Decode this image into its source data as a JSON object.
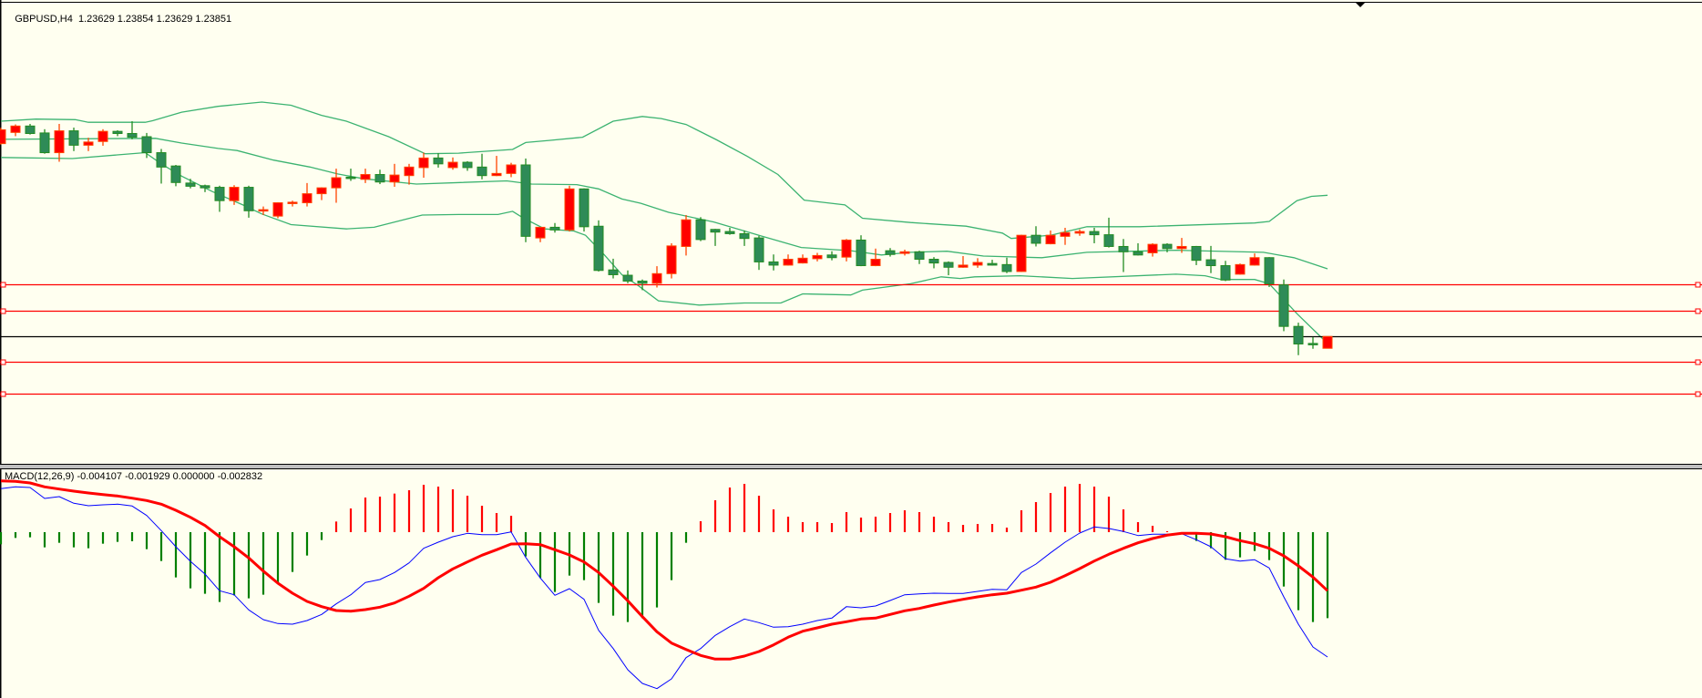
{
  "main_panel": {
    "symbol_timeframe": "GBPUSD,H4",
    "ohlc_readout": "1.23629 1.23854 1.23629 1.23851",
    "bid_price": 1.23851,
    "horizontal_levels": [
      1.2483,
      1.2433,
      1.2337,
      1.2277
    ],
    "colors": {
      "bull_body": "#FF0000",
      "bull_outline": "#FF4500",
      "bear_body": "#2E8B57",
      "bear_outline": "#228B22",
      "bands": "#3CB371",
      "level": "#FF0000",
      "bid": "#000000",
      "background": "#FFFFF0"
    },
    "candles_ohlc": [
      [
        1.2747,
        1.2777,
        1.2745,
        1.2773
      ],
      [
        1.2768,
        1.2783,
        1.2761,
        1.278
      ],
      [
        1.278,
        1.2784,
        1.2764,
        1.2766
      ],
      [
        1.2767,
        1.2774,
        1.2728,
        1.273
      ],
      [
        1.273,
        1.2784,
        1.2713,
        1.2771
      ],
      [
        1.2771,
        1.2777,
        1.2733,
        1.2744
      ],
      [
        1.2744,
        1.2758,
        1.2733,
        1.275
      ],
      [
        1.2751,
        1.2774,
        1.2743,
        1.277
      ],
      [
        1.277,
        1.2772,
        1.2761,
        1.2766
      ],
      [
        1.2766,
        1.2789,
        1.2755,
        1.2759
      ],
      [
        1.276,
        1.2767,
        1.272,
        1.273
      ],
      [
        1.273,
        1.2737,
        1.2672,
        1.2703
      ],
      [
        1.2705,
        1.2707,
        1.2667,
        1.2674
      ],
      [
        1.2673,
        1.2681,
        1.2663,
        1.2667
      ],
      [
        1.2668,
        1.267,
        1.2656,
        1.2664
      ],
      [
        1.2665,
        1.2668,
        1.2619,
        1.264
      ],
      [
        1.264,
        1.2669,
        1.2632,
        1.2665
      ],
      [
        1.2665,
        1.2668,
        1.2608,
        1.2621
      ],
      [
        1.2621,
        1.2629,
        1.2613,
        1.2623
      ],
      [
        1.2611,
        1.2637,
        1.2607,
        1.2636
      ],
      [
        1.2636,
        1.264,
        1.2629,
        1.2637
      ],
      [
        1.2636,
        1.2673,
        1.2629,
        1.2653
      ],
      [
        1.2653,
        1.2665,
        1.2641,
        1.2664
      ],
      [
        1.2664,
        1.27,
        1.2636,
        1.2683
      ],
      [
        1.2684,
        1.27,
        1.2677,
        1.2683
      ],
      [
        1.268,
        1.27,
        1.2673,
        1.2689
      ],
      [
        1.2689,
        1.2698,
        1.2671,
        1.2675
      ],
      [
        1.2675,
        1.2709,
        1.2666,
        1.2688
      ],
      [
        1.2687,
        1.2709,
        1.267,
        1.2703
      ],
      [
        1.2702,
        1.273,
        1.2683,
        1.272
      ],
      [
        1.272,
        1.2729,
        1.2702,
        1.2709
      ],
      [
        1.2702,
        1.2721,
        1.2698,
        1.2712
      ],
      [
        1.2712,
        1.2714,
        1.2696,
        1.2702
      ],
      [
        1.2703,
        1.2728,
        1.268,
        1.2687
      ],
      [
        1.2687,
        1.2724,
        1.2686,
        1.2691
      ],
      [
        1.2691,
        1.2711,
        1.2684,
        1.2707
      ],
      [
        1.2707,
        1.2719,
        1.2562,
        1.2573
      ],
      [
        1.257,
        1.259,
        1.2562,
        1.259
      ],
      [
        1.259,
        1.2598,
        1.258,
        1.2585
      ],
      [
        1.2585,
        1.2668,
        1.2582,
        1.2662
      ],
      [
        1.2662,
        1.2663,
        1.2582,
        1.2591
      ],
      [
        1.2592,
        1.2603,
        1.2507,
        1.2509
      ],
      [
        1.251,
        1.2531,
        1.2494,
        1.2501
      ],
      [
        1.25,
        1.2509,
        1.2485,
        1.2489
      ],
      [
        1.2489,
        1.2492,
        1.2472,
        1.2485
      ],
      [
        1.2485,
        1.2517,
        1.2477,
        1.2503
      ],
      [
        1.2503,
        1.256,
        1.2494,
        1.2555
      ],
      [
        1.2554,
        1.2613,
        1.2537,
        1.2604
      ],
      [
        1.2604,
        1.2609,
        1.2564,
        1.2567
      ],
      [
        1.2586,
        1.2587,
        1.2555,
        1.2581
      ],
      [
        1.2582,
        1.2589,
        1.2576,
        1.2578
      ],
      [
        1.2578,
        1.2584,
        1.2555,
        1.2569
      ],
      [
        1.257,
        1.2574,
        1.251,
        1.2525
      ],
      [
        1.2525,
        1.2539,
        1.2509,
        1.2519
      ],
      [
        1.2519,
        1.2539,
        1.2518,
        1.253
      ],
      [
        1.2523,
        1.2539,
        1.2522,
        1.2532
      ],
      [
        1.2531,
        1.2542,
        1.2526,
        1.2537
      ],
      [
        1.2538,
        1.2545,
        1.2528,
        1.2533
      ],
      [
        1.2534,
        1.2568,
        1.2526,
        1.2566
      ],
      [
        1.2566,
        1.2575,
        1.2517,
        1.2518
      ],
      [
        1.2518,
        1.255,
        1.2517,
        1.253
      ],
      [
        1.2546,
        1.2551,
        1.2535,
        1.2539
      ],
      [
        1.2541,
        1.2548,
        1.2537,
        1.2544
      ],
      [
        1.2544,
        1.2546,
        1.2521,
        1.253
      ],
      [
        1.253,
        1.2534,
        1.2513,
        1.2523
      ],
      [
        1.2524,
        1.2526,
        1.25,
        1.2515
      ],
      [
        1.2515,
        1.2536,
        1.2514,
        1.2519
      ],
      [
        1.2519,
        1.2532,
        1.2514,
        1.2524
      ],
      [
        1.2522,
        1.2529,
        1.2518,
        1.2519
      ],
      [
        1.252,
        1.2533,
        1.2504,
        1.2507
      ],
      [
        1.2507,
        1.2576,
        1.2506,
        1.2575
      ],
      [
        1.2575,
        1.2592,
        1.2554,
        1.256
      ],
      [
        1.2559,
        1.2584,
        1.2558,
        1.2575
      ],
      [
        1.2573,
        1.2589,
        1.2557,
        1.258
      ],
      [
        1.2579,
        1.2586,
        1.2574,
        1.2582
      ],
      [
        1.2582,
        1.2589,
        1.256,
        1.2576
      ],
      [
        1.2576,
        1.2608,
        1.2552,
        1.2554
      ],
      [
        1.2554,
        1.2568,
        1.2506,
        1.2544
      ],
      [
        1.2544,
        1.256,
        1.2537,
        1.2538
      ],
      [
        1.2542,
        1.256,
        1.2535,
        1.2558
      ],
      [
        1.2558,
        1.256,
        1.2543,
        1.255
      ],
      [
        1.255,
        1.257,
        1.2542,
        1.2554
      ],
      [
        1.2554,
        1.2555,
        1.2519,
        1.2528
      ],
      [
        1.2529,
        1.2555,
        1.2504,
        1.2518
      ],
      [
        1.2518,
        1.2527,
        1.2489,
        1.2491
      ],
      [
        1.2502,
        1.2522,
        1.2501,
        1.252
      ],
      [
        1.2519,
        1.2541,
        1.2518,
        1.2533
      ],
      [
        1.2533,
        1.2534,
        1.2478,
        1.2484
      ],
      [
        1.2482,
        1.2492,
        1.2395,
        1.2404
      ],
      [
        1.2404,
        1.2411,
        1.235,
        1.2371
      ],
      [
        1.2372,
        1.2384,
        1.2362,
        1.237
      ],
      [
        1.23629,
        1.23854,
        1.23629,
        1.23851
      ]
    ],
    "bollinger_upper": [
      [
        0,
        1.2789
      ],
      [
        2.4,
        1.2793
      ],
      [
        5.1,
        1.2792
      ],
      [
        6,
        1.2787
      ],
      [
        9.9,
        1.2787
      ],
      [
        10.4,
        1.279
      ],
      [
        12.4,
        1.2806
      ],
      [
        14.9,
        1.2817
      ],
      [
        17.9,
        1.2825
      ],
      [
        19.9,
        1.2819
      ],
      [
        22,
        1.28
      ],
      [
        23.7,
        1.2789
      ],
      [
        26.6,
        1.276
      ],
      [
        29.1,
        1.2728
      ],
      [
        31.4,
        1.2729
      ],
      [
        35.1,
        1.2736
      ],
      [
        36,
        1.2749
      ],
      [
        37.6,
        1.2753
      ],
      [
        39.9,
        1.2759
      ],
      [
        42,
        1.2789
      ],
      [
        44,
        1.2798
      ],
      [
        45.3,
        1.2794
      ],
      [
        47,
        1.2783
      ],
      [
        49.1,
        1.2754
      ],
      [
        51.2,
        1.2723
      ],
      [
        53.3,
        1.2689
      ],
      [
        55.1,
        1.2641
      ],
      [
        57.9,
        1.2632
      ],
      [
        59.1,
        1.2607
      ],
      [
        62.4,
        1.2599
      ],
      [
        66.2,
        1.2592
      ],
      [
        68.7,
        1.2579
      ],
      [
        69.3,
        1.2569
      ],
      [
        72,
        1.2575
      ],
      [
        74.5,
        1.2591
      ],
      [
        78.1,
        1.2591
      ],
      [
        86,
        1.2598
      ],
      [
        87,
        1.2601
      ],
      [
        88.9,
        1.264
      ],
      [
        89.9,
        1.2648
      ],
      [
        91,
        1.265
      ]
    ],
    "bollinger_middle": [
      [
        0,
        1.2755
      ],
      [
        10.6,
        1.2757
      ],
      [
        12.4,
        1.2748
      ],
      [
        14.9,
        1.2738
      ],
      [
        16.2,
        1.2734
      ],
      [
        18.7,
        1.2716
      ],
      [
        21.2,
        1.2703
      ],
      [
        23.1,
        1.269
      ],
      [
        24.9,
        1.2681
      ],
      [
        28.5,
        1.2671
      ],
      [
        34.7,
        1.2677
      ],
      [
        36.4,
        1.2671
      ],
      [
        39.5,
        1.267
      ],
      [
        41,
        1.2662
      ],
      [
        42.6,
        1.2643
      ],
      [
        43.9,
        1.2635
      ],
      [
        45.8,
        1.2618
      ],
      [
        48.9,
        1.26
      ],
      [
        52,
        1.2575
      ],
      [
        54.9,
        1.2552
      ],
      [
        58.3,
        1.2546
      ],
      [
        60.4,
        1.2538
      ],
      [
        62.4,
        1.2543
      ],
      [
        64.9,
        1.2545
      ],
      [
        67.4,
        1.2536
      ],
      [
        71.4,
        1.2533
      ],
      [
        74.5,
        1.2543
      ],
      [
        80.6,
        1.2547
      ],
      [
        86.6,
        1.2543
      ],
      [
        88.7,
        1.2533
      ],
      [
        91,
        1.2512
      ]
    ],
    "bollinger_lower": [
      [
        0,
        1.2721
      ],
      [
        4.9,
        1.2719
      ],
      [
        9.9,
        1.273
      ],
      [
        11,
        1.2709
      ],
      [
        12.4,
        1.2686
      ],
      [
        14.5,
        1.2657
      ],
      [
        16.6,
        1.2632
      ],
      [
        17.9,
        1.2615
      ],
      [
        19.9,
        1.2595
      ],
      [
        23.7,
        1.2587
      ],
      [
        25.6,
        1.259
      ],
      [
        28.9,
        1.2613
      ],
      [
        31.4,
        1.2614
      ],
      [
        34.1,
        1.2614
      ],
      [
        35.1,
        1.262
      ],
      [
        35.8,
        1.2608
      ],
      [
        37.3,
        1.2587
      ],
      [
        39.3,
        1.2583
      ],
      [
        40.1,
        1.2575
      ],
      [
        41.4,
        1.2538
      ],
      [
        42.6,
        1.2501
      ],
      [
        43.7,
        1.2481
      ],
      [
        45.1,
        1.2452
      ],
      [
        47.9,
        1.2444
      ],
      [
        51,
        1.2448
      ],
      [
        53.5,
        1.2448
      ],
      [
        55,
        1.2465
      ],
      [
        58.3,
        1.2463
      ],
      [
        59.1,
        1.2472
      ],
      [
        62.4,
        1.2484
      ],
      [
        64.5,
        1.2497
      ],
      [
        65.8,
        1.2494
      ],
      [
        66.8,
        1.2497
      ],
      [
        69.9,
        1.2499
      ],
      [
        73.5,
        1.2494
      ],
      [
        80.6,
        1.2502
      ],
      [
        82.6,
        1.2499
      ],
      [
        83.7,
        1.2492
      ],
      [
        86,
        1.2492
      ],
      [
        87,
        1.2484
      ],
      [
        88.9,
        1.2428
      ],
      [
        91,
        1.2372
      ]
    ]
  },
  "macd_panel": {
    "label": "MACD(12,26,9) -0.004107 -0.001929 0.000000 -0.002832",
    "colors": {
      "hist_up": "#FF0000",
      "hist_down": "#008000",
      "macd_line": "#0000FF",
      "signal_line": "#FF0000"
    },
    "value_multiplier": 1e-05,
    "histogram": [
      -40,
      -19,
      -17,
      -50,
      -35,
      -50,
      -53,
      -38,
      -32,
      -30,
      -56,
      -95,
      -149,
      -185,
      -203,
      -230,
      -208,
      -218,
      -206,
      -170,
      -131,
      -77,
      -26,
      35,
      78,
      114,
      117,
      127,
      138,
      156,
      150,
      141,
      120,
      87,
      63,
      54,
      -80,
      -151,
      -197,
      -143,
      -158,
      -233,
      -275,
      -296,
      -283,
      -248,
      -158,
      -35,
      36,
      105,
      147,
      159,
      120,
      75,
      51,
      33,
      33,
      30,
      66,
      48,
      51,
      63,
      72,
      66,
      51,
      33,
      24,
      27,
      27,
      15,
      72,
      99,
      129,
      150,
      159,
      150,
      117,
      75,
      33,
      21,
      3,
      -5,
      -29,
      -53,
      -91,
      -83,
      -62,
      -92,
      -179,
      -257,
      -296,
      -283
    ],
    "macd": [
      143,
      149,
      147,
      111,
      117,
      95,
      87,
      90,
      92,
      86,
      55,
      5,
      -48,
      -96,
      -138,
      -193,
      -206,
      -256,
      -288,
      -301,
      -303,
      -291,
      -271,
      -236,
      -206,
      -166,
      -156,
      -133,
      -101,
      -53,
      -33,
      -15,
      -4,
      -8,
      -8,
      1,
      -83,
      -151,
      -208,
      -186,
      -221,
      -323,
      -383,
      -453,
      -498,
      -515,
      -483,
      -413,
      -383,
      -340,
      -311,
      -286,
      -298,
      -313,
      -311,
      -303,
      -291,
      -283,
      -245,
      -249,
      -243,
      -225,
      -206,
      -203,
      -201,
      -202,
      -202,
      -195,
      -188,
      -190,
      -133,
      -105,
      -68,
      -33,
      -3,
      17,
      12,
      2,
      -11,
      -7,
      -7,
      -5,
      -25,
      -48,
      -88,
      -95,
      -91,
      -118,
      -213,
      -303,
      -378,
      -411
    ],
    "signal": [
      169,
      167,
      162,
      149,
      142,
      135,
      129,
      124,
      119,
      112,
      104,
      92,
      72,
      49,
      22,
      -15,
      -48,
      -85,
      -128,
      -168,
      -201,
      -228,
      -245,
      -258,
      -260,
      -255,
      -247,
      -233,
      -211,
      -185,
      -150,
      -121,
      -98,
      -76,
      -58,
      -39,
      -38,
      -41,
      -58,
      -75,
      -98,
      -133,
      -178,
      -226,
      -278,
      -328,
      -365,
      -386,
      -406,
      -418,
      -418,
      -408,
      -393,
      -371,
      -346,
      -326,
      -315,
      -303,
      -295,
      -286,
      -283,
      -271,
      -259,
      -251,
      -240,
      -230,
      -221,
      -213,
      -206,
      -201,
      -191,
      -181,
      -165,
      -143,
      -120,
      -95,
      -73,
      -53,
      -35,
      -21,
      -10,
      -4,
      -4,
      -6,
      -15,
      -28,
      -38,
      -53,
      -78,
      -111,
      -148,
      -193
    ]
  }
}
